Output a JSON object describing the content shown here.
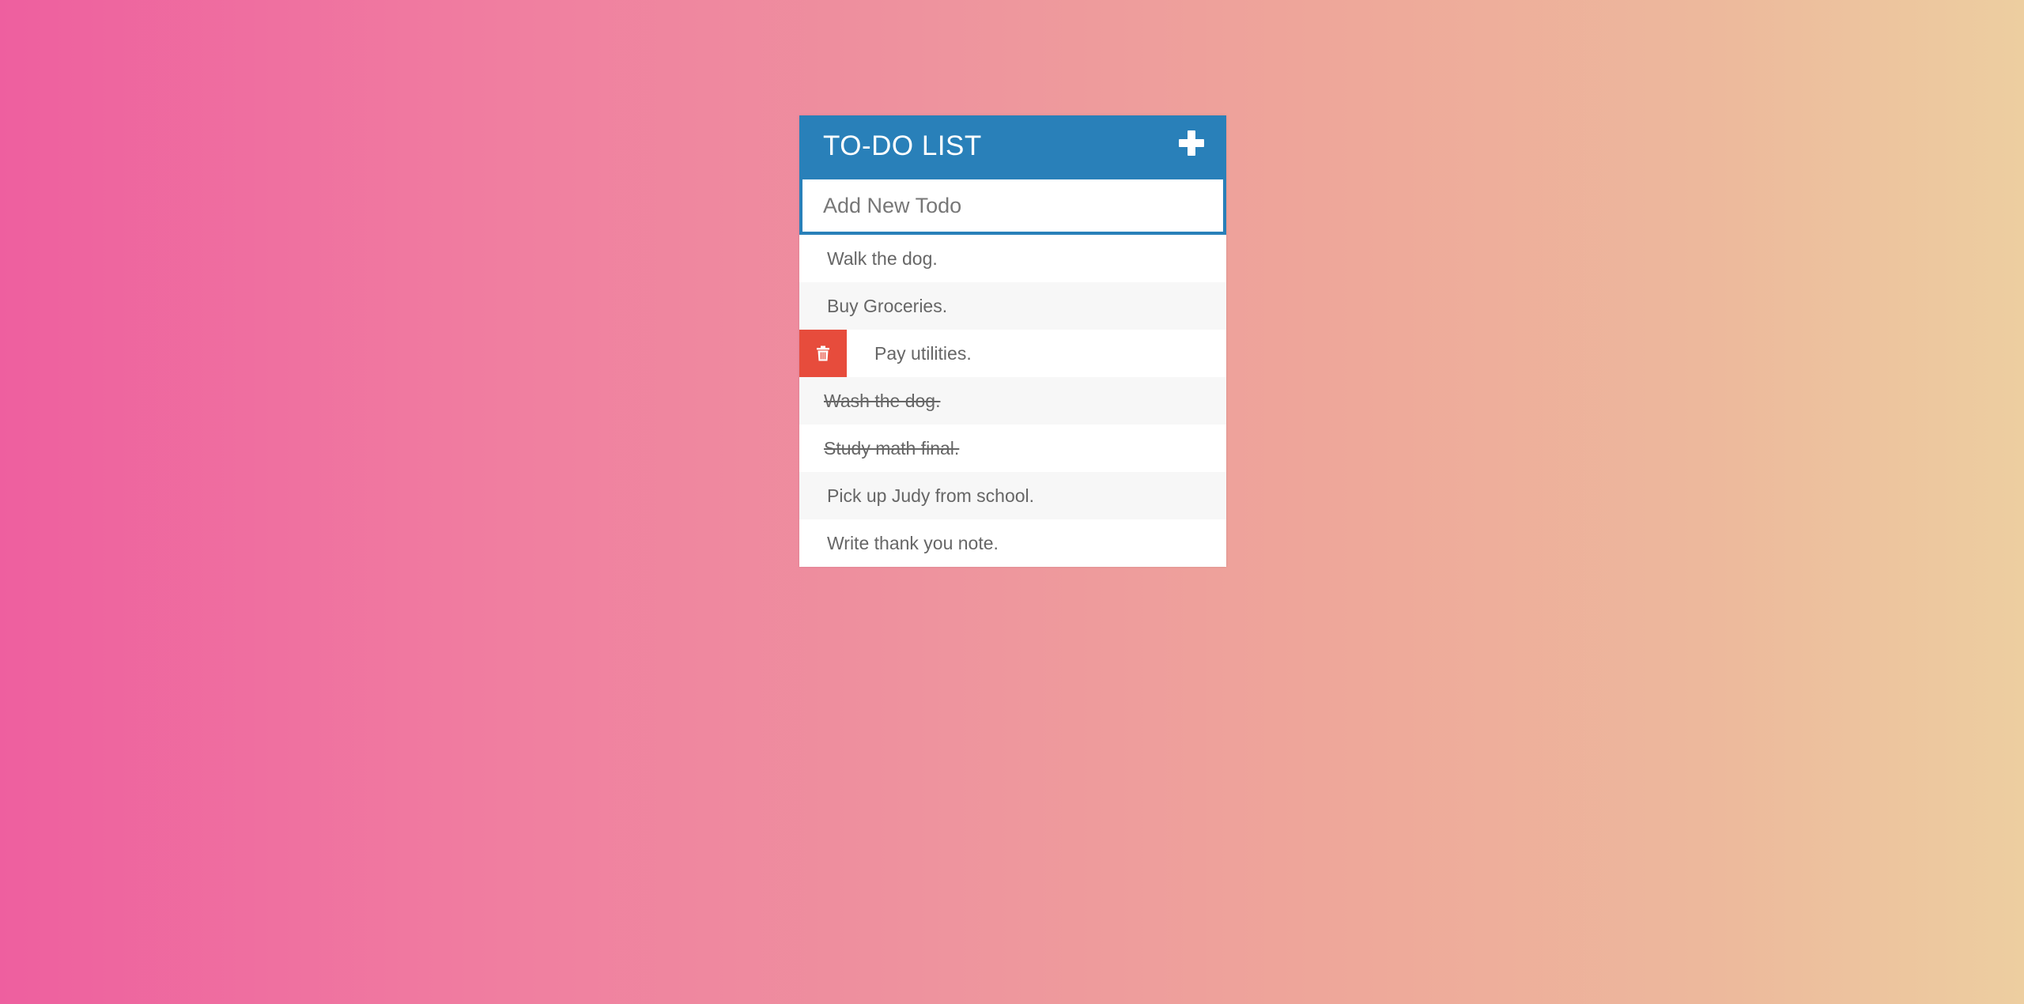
{
  "header": {
    "title": "TO-DO LIST",
    "add_icon": "plus-icon"
  },
  "input": {
    "placeholder": "Add New Todo",
    "value": ""
  },
  "todos": [
    {
      "text": "Walk the dog.",
      "completed": false,
      "hovered": false
    },
    {
      "text": "Buy Groceries.",
      "completed": false,
      "hovered": false
    },
    {
      "text": "Pay utilities.",
      "completed": false,
      "hovered": true
    },
    {
      "text": "Wash the dog.",
      "completed": true,
      "hovered": false
    },
    {
      "text": "Study math final.",
      "completed": true,
      "hovered": false
    },
    {
      "text": "Pick up Judy from school.",
      "completed": false,
      "hovered": false
    },
    {
      "text": "Write thank you note.",
      "completed": false,
      "hovered": false
    }
  ],
  "delete_icon": "trash-icon",
  "colors": {
    "header": "#2980b9",
    "delete": "#e74c3c",
    "text": "#666666",
    "gradient_start": "#ee5f9f",
    "gradient_end": "#edcea0"
  }
}
